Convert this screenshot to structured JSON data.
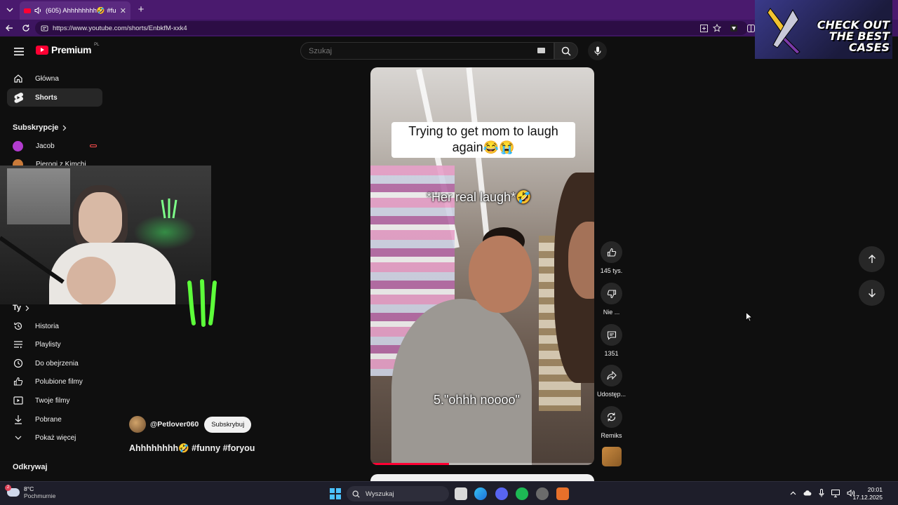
{
  "browser": {
    "tab_title": "(605) Ahhhhhhhh🤣 #funny #foryou",
    "tab_close": "✕",
    "new_tab": "+",
    "url": "https://www.youtube.com/shorts/EnbkfM-xxk4"
  },
  "youtube": {
    "logo_text": "Premium",
    "logo_country": "PL",
    "search_placeholder": "Szukaj",
    "sidebar": {
      "main_items": [
        {
          "label": "Główna",
          "icon": "home-icon"
        },
        {
          "label": "Shorts",
          "icon": "shorts-icon",
          "active": true
        }
      ],
      "subscriptions_header": "Subskrypcje",
      "subscriptions": [
        {
          "label": "Jacob",
          "color": "#b23ccf"
        },
        {
          "label": "Pierogi z Kimchi",
          "color": "#c97a3a"
        }
      ],
      "you_header": "Ty",
      "you_items": [
        {
          "label": "Historia",
          "icon": "history-icon"
        },
        {
          "label": "Playlisty",
          "icon": "playlist-icon"
        },
        {
          "label": "Do obejrzenia",
          "icon": "clock-icon"
        },
        {
          "label": "Polubione filmy",
          "icon": "thumb-up-icon"
        },
        {
          "label": "Twoje filmy",
          "icon": "video-icon"
        },
        {
          "label": "Pobrane",
          "icon": "download-icon"
        },
        {
          "label": "Pokaż więcej",
          "icon": "chevron-down-icon"
        }
      ],
      "explore_header": "Odkrywaj"
    },
    "short": {
      "caption_top": "Trying to get mom to laugh again😂😭",
      "caption_mid": "*Her real laugh*🤣",
      "caption_bottom": "5.\"ohhh noooo\"",
      "progress": 0.35,
      "channel": "@Petlover060",
      "subscribe_label": "Subskrybuj",
      "title": "Ahhhhhhhh🤣 #funny #foryou"
    },
    "actions": {
      "likes": "145 tys.",
      "dislike": "Nie ...",
      "comments": "1351",
      "share": "Udostęp...",
      "remix": "Remiks"
    },
    "accent": "#ff0033"
  },
  "ad": {
    "text_line1": "CHECK OUT",
    "text_line2": "THE BEST",
    "text_line3": "CASES"
  },
  "taskbar": {
    "weather_temp": "8°C",
    "weather_cond": "Pochmurnie",
    "weather_badge": "2",
    "search_label": "Wyszukaj",
    "time": "20:01",
    "date": "17.12.2025"
  }
}
